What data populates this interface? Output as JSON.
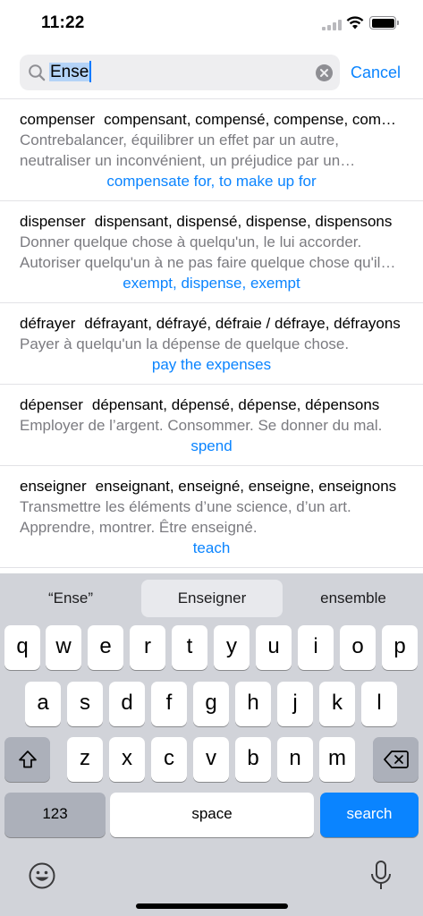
{
  "status": {
    "time": "11:22"
  },
  "search": {
    "query": "Ense",
    "cancel_label": "Cancel"
  },
  "results": [
    {
      "verb": "compenser",
      "forms": "compensant, compensé, compense, compensons",
      "definition": "Contrebalancer, équilibrer un effet par un autre, neutraliser un inconvénient, un préjudice par un avantage.",
      "translation": "compensate for, to make up for"
    },
    {
      "verb": "dispenser",
      "forms": "dispensant, dispensé, dispense, dispensons",
      "definition": "Donner quelque chose à quelqu'un, le lui accorder. Autoriser quelqu'un à ne pas faire quelque chose qu'il devrait faire.",
      "translation": "exempt, dispense, exempt"
    },
    {
      "verb": "défrayer",
      "forms": "défrayant, défrayé, défraie / défraye, défrayons",
      "definition": "Payer à quelqu'un la dépense de quelque chose.",
      "translation": "pay the expenses"
    },
    {
      "verb": "dépenser",
      "forms": "dépensant, dépensé, dépense, dépensons",
      "definition": "Employer de l’argent. Consommer. Se donner du mal.",
      "translation": "spend"
    },
    {
      "verb": "enseigner",
      "forms": "enseignant, enseigné, enseigne, enseignons",
      "definition": "Transmettre les éléments d’une science, d’un art. Apprendre, montrer. Être enseigné.",
      "translation": "teach"
    }
  ],
  "keyboard": {
    "suggestions": [
      "“Ense”",
      "Enseigner",
      "ensemble"
    ],
    "row1": [
      "q",
      "w",
      "e",
      "r",
      "t",
      "y",
      "u",
      "i",
      "o",
      "p"
    ],
    "row2": [
      "a",
      "s",
      "d",
      "f",
      "g",
      "h",
      "j",
      "k",
      "l"
    ],
    "row3": [
      "z",
      "x",
      "c",
      "v",
      "b",
      "n",
      "m"
    ],
    "numbers_label": "123",
    "space_label": "space",
    "search_label": "search",
    "accent_color": "#0a84ff"
  }
}
